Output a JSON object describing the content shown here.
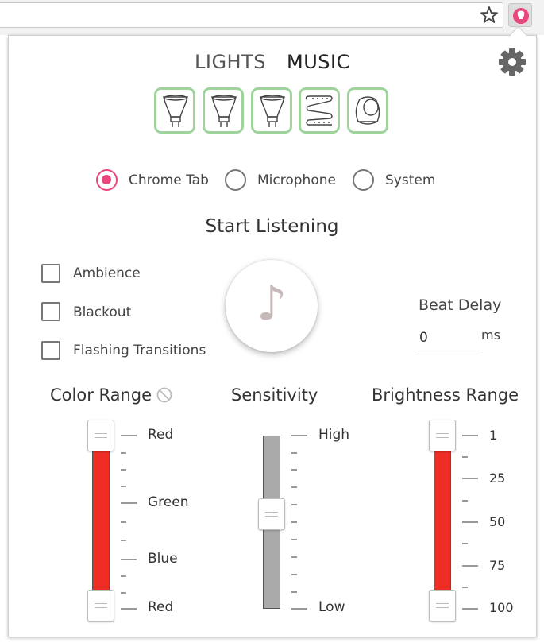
{
  "browser": {
    "star_icon": "star-icon",
    "extension_icon": "extension-icon"
  },
  "tabs": [
    {
      "label": "LIGHTS"
    },
    {
      "label": "MUSIC",
      "active": true
    }
  ],
  "settings_icon": "gear-icon",
  "lights": [
    {
      "icon": "spot-bulb-icon"
    },
    {
      "icon": "spot-bulb-icon"
    },
    {
      "icon": "spot-bulb-icon"
    },
    {
      "icon": "lightstrip-icon"
    },
    {
      "icon": "bloom-lamp-icon"
    }
  ],
  "audio_source": {
    "options": [
      "Chrome Tab",
      "Microphone",
      "System"
    ],
    "selected": "Chrome Tab"
  },
  "start_label": "Start Listening",
  "options": [
    {
      "label": "Ambience",
      "checked": false
    },
    {
      "label": "Blackout",
      "checked": false
    },
    {
      "label": "Flashing Transitions",
      "checked": false
    }
  ],
  "music_button_icon": "music-note-icon",
  "beat_delay": {
    "label": "Beat Delay",
    "value": "0",
    "unit": "ms"
  },
  "sliders": {
    "color_range": {
      "title": "Color Range",
      "labels": [
        "Red",
        "Green",
        "Blue",
        "Red"
      ],
      "range": [
        0,
        1
      ]
    },
    "sensitivity": {
      "title": "Sensitivity",
      "labels": [
        "High",
        "Low"
      ],
      "value": 0.45
    },
    "brightness_range": {
      "title": "Brightness Range",
      "labels": [
        "1",
        "25",
        "50",
        "75",
        "100"
      ],
      "range": [
        1,
        100
      ]
    }
  },
  "colors": {
    "accent": "#e9467c",
    "bulb_border": "#9ed39c",
    "range_fill": "#ee2d24",
    "sensitivity_fill": "#aaaaaa"
  }
}
